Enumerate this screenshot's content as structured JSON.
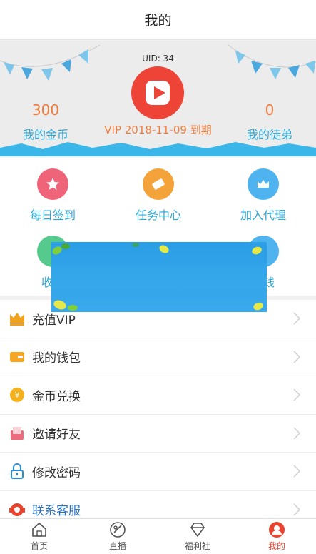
{
  "header": {
    "title": "我的"
  },
  "profile": {
    "uid": "UID: 34",
    "coins_value": "300",
    "coins_label": "我的金币",
    "vip_text": "VIP 2018-11-09 到期",
    "apprentice_value": "0",
    "apprentice_label": "我的徒弟"
  },
  "grid": {
    "items": [
      {
        "label": "每日签到",
        "color": "#f0647a"
      },
      {
        "label": "任务中心",
        "color": "#f4a33a"
      },
      {
        "label": "加入代理",
        "color": "#4fb3ef"
      },
      {
        "label": "收支",
        "color": "#56c98c"
      },
      {
        "label": "赚钱",
        "color": "#4fb3ef"
      }
    ]
  },
  "menu": {
    "items": [
      {
        "label": "充值VIP",
        "icon": "crown-icon"
      },
      {
        "label": "我的钱包",
        "icon": "wallet-icon"
      },
      {
        "label": "金币兑换",
        "icon": "coin-icon"
      },
      {
        "label": "邀请好友",
        "icon": "invite-icon"
      },
      {
        "label": "修改密码",
        "icon": "lock-icon"
      },
      {
        "label": "联系客服",
        "icon": "service-icon"
      }
    ]
  },
  "tabbar": {
    "items": [
      {
        "label": "首页",
        "icon": "home-icon"
      },
      {
        "label": "直播",
        "icon": "live-icon"
      },
      {
        "label": "福利社",
        "icon": "diamond-icon"
      },
      {
        "label": "我的",
        "icon": "profile-icon",
        "active": true
      }
    ]
  },
  "colors": {
    "accent": "#2ba8d6",
    "orange": "#f07c3b",
    "red": "#ee4437",
    "active_tab": "#e8442f"
  }
}
